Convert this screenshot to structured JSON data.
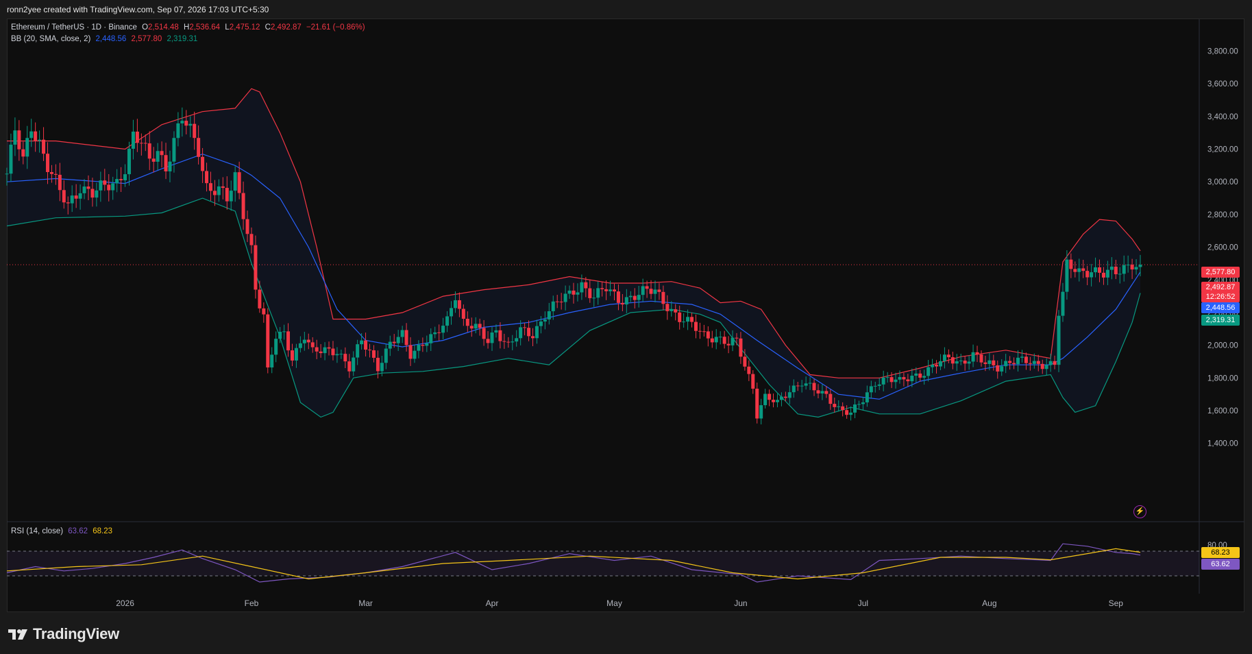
{
  "header": {
    "created_text": "ronn2yee created with TradingView.com, Sep 07, 2026 17:03 UTC+5:30"
  },
  "legend": {
    "symbol": "Ethereum / TetherUS · 1D · Binance",
    "o_label": "O",
    "o_value": "2,514.48",
    "h_label": "H",
    "h_value": "2,536.64",
    "l_label": "L",
    "l_value": "2,475.12",
    "c_label": "C",
    "c_value": "2,492.87",
    "change": "−21.61 (−0.86%)",
    "bb_label": "BB (20, SMA, close, 2)",
    "bb_basis": "2,448.56",
    "bb_upper": "2,577.80",
    "bb_lower": "2,319.31"
  },
  "rsi_legend": {
    "label": "RSI (14, close)",
    "rsi_value": "63.62",
    "ma_value": "68.23"
  },
  "price_tags": {
    "upper": "2,577.80",
    "last": "2,492.87",
    "countdown": "12:26:52",
    "basis": "2,448.56",
    "lower": "2,319.31",
    "rsi_ma": "68.23",
    "rsi": "63.62"
  },
  "branding": {
    "name": "TradingView"
  },
  "colors": {
    "up": "#089981",
    "down": "#f23645",
    "upper_band": "#f23645",
    "basis": "#2962ff",
    "lower_band": "#089981",
    "rsi": "#7e57c2",
    "rsi_ma": "#f5c518"
  },
  "chart_data": {
    "type": "candlestick",
    "title": "Ethereum / TetherUS · 1D · Binance",
    "y_axis": {
      "ticks": [
        1400,
        1600,
        1800,
        2000,
        2200,
        2400,
        2600,
        2800,
        3000,
        3200,
        3400,
        3600,
        3800
      ],
      "tick_labels": [
        "1,400.00",
        "1,600.00",
        "1,800.00",
        "2,000.00",
        "2,200.00",
        "2,400.00",
        "2,600.00",
        "2,800.00",
        "3,000.00",
        "3,200.00",
        "3,400.00",
        "3,600.00",
        "3,800.00"
      ]
    },
    "x_axis": {
      "labels": [
        {
          "date": "2026-01-01",
          "text": "2026"
        },
        {
          "date": "2026-02-01",
          "text": "Feb"
        },
        {
          "date": "2026-03-01",
          "text": "Mar"
        },
        {
          "date": "2026-04-01",
          "text": "Apr"
        },
        {
          "date": "2026-05-01",
          "text": "May"
        },
        {
          "date": "2026-06-01",
          "text": "Jun"
        },
        {
          "date": "2026-07-01",
          "text": "Jul"
        },
        {
          "date": "2026-08-01",
          "text": "Aug"
        },
        {
          "date": "2026-09-01",
          "text": "Sep"
        }
      ]
    },
    "close_path": [
      [
        "2025-12-03",
        3050
      ],
      [
        "2025-12-05",
        3300
      ],
      [
        "2025-12-07",
        3120
      ],
      [
        "2025-12-09",
        3350
      ],
      [
        "2025-12-11",
        3250
      ],
      [
        "2025-12-13",
        3100
      ],
      [
        "2025-12-16",
        2930
      ],
      [
        "2025-12-18",
        2850
      ],
      [
        "2025-12-21",
        2980
      ],
      [
        "2025-12-24",
        2930
      ],
      [
        "2025-12-27",
        2960
      ],
      [
        "2025-12-30",
        3000
      ],
      [
        "2026-01-01",
        3100
      ],
      [
        "2026-01-03",
        3280
      ],
      [
        "2026-01-05",
        3230
      ],
      [
        "2026-01-07",
        3120
      ],
      [
        "2026-01-09",
        3200
      ],
      [
        "2026-01-11",
        3100
      ],
      [
        "2026-01-13",
        3250
      ],
      [
        "2026-01-15",
        3380
      ],
      [
        "2026-01-17",
        3300
      ],
      [
        "2026-01-19",
        3200
      ],
      [
        "2026-01-21",
        2980
      ],
      [
        "2026-01-24",
        2950
      ],
      [
        "2026-01-26",
        2880
      ],
      [
        "2026-01-28",
        3020
      ],
      [
        "2026-01-30",
        2820
      ],
      [
        "2026-02-01",
        2600
      ],
      [
        "2026-02-02",
        2350
      ],
      [
        "2026-02-03",
        2250
      ],
      [
        "2026-02-04",
        2170
      ],
      [
        "2026-02-05",
        1830
      ],
      [
        "2026-02-07",
        2050
      ],
      [
        "2026-02-09",
        2080
      ],
      [
        "2026-02-11",
        1930
      ],
      [
        "2026-02-14",
        2050
      ],
      [
        "2026-02-16",
        1950
      ],
      [
        "2026-02-19",
        1980
      ],
      [
        "2026-02-22",
        1970
      ],
      [
        "2026-02-25",
        1850
      ],
      [
        "2026-02-28",
        2030
      ],
      [
        "2026-03-02",
        1970
      ],
      [
        "2026-03-04",
        1870
      ],
      [
        "2026-03-07",
        2000
      ],
      [
        "2026-03-10",
        2060
      ],
      [
        "2026-03-12",
        1950
      ],
      [
        "2026-03-15",
        2020
      ],
      [
        "2026-03-18",
        2050
      ],
      [
        "2026-03-21",
        2150
      ],
      [
        "2026-03-23",
        2320
      ],
      [
        "2026-03-25",
        2150
      ],
      [
        "2026-03-28",
        2100
      ],
      [
        "2026-03-31",
        2020
      ],
      [
        "2026-04-02",
        2100
      ],
      [
        "2026-04-05",
        2000
      ],
      [
        "2026-04-08",
        2080
      ],
      [
        "2026-04-11",
        2060
      ],
      [
        "2026-04-14",
        2200
      ],
      [
        "2026-04-17",
        2260
      ],
      [
        "2026-04-20",
        2300
      ],
      [
        "2026-04-23",
        2380
      ],
      [
        "2026-04-26",
        2300
      ],
      [
        "2026-04-29",
        2340
      ],
      [
        "2026-05-02",
        2280
      ],
      [
        "2026-05-05",
        2300
      ],
      [
        "2026-05-08",
        2320
      ],
      [
        "2026-05-11",
        2330
      ],
      [
        "2026-05-14",
        2250
      ],
      [
        "2026-05-17",
        2160
      ],
      [
        "2026-05-20",
        2120
      ],
      [
        "2026-05-23",
        2070
      ],
      [
        "2026-05-26",
        2050
      ],
      [
        "2026-05-29",
        2000
      ],
      [
        "2026-05-31",
        2020
      ],
      [
        "2026-06-02",
        1880
      ],
      [
        "2026-06-04",
        1750
      ],
      [
        "2026-06-05",
        1580
      ],
      [
        "2026-06-07",
        1680
      ],
      [
        "2026-06-10",
        1640
      ],
      [
        "2026-06-13",
        1730
      ],
      [
        "2026-06-16",
        1780
      ],
      [
        "2026-06-19",
        1720
      ],
      [
        "2026-06-22",
        1690
      ],
      [
        "2026-06-25",
        1620
      ],
      [
        "2026-06-28",
        1580
      ],
      [
        "2026-07-01",
        1660
      ],
      [
        "2026-07-04",
        1780
      ],
      [
        "2026-07-07",
        1800
      ],
      [
        "2026-07-10",
        1770
      ],
      [
        "2026-07-13",
        1810
      ],
      [
        "2026-07-16",
        1840
      ],
      [
        "2026-07-19",
        1880
      ],
      [
        "2026-07-22",
        1920
      ],
      [
        "2026-07-25",
        1900
      ],
      [
        "2026-07-28",
        1940
      ],
      [
        "2026-07-31",
        1880
      ],
      [
        "2026-08-03",
        1870
      ],
      [
        "2026-08-06",
        1910
      ],
      [
        "2026-08-09",
        1900
      ],
      [
        "2026-08-12",
        1880
      ],
      [
        "2026-08-15",
        1895
      ],
      [
        "2026-08-17",
        1890
      ],
      [
        "2026-08-18",
        2200
      ],
      [
        "2026-08-19",
        2300
      ],
      [
        "2026-08-20",
        2480
      ],
      [
        "2026-08-23",
        2450
      ],
      [
        "2026-08-26",
        2470
      ],
      [
        "2026-08-29",
        2430
      ],
      [
        "2026-09-01",
        2440
      ],
      [
        "2026-09-03",
        2480
      ],
      [
        "2026-09-05",
        2510
      ],
      [
        "2026-09-07",
        2492.87
      ]
    ],
    "bollinger_upper_path": [
      [
        "2025-12-03",
        3250
      ],
      [
        "2025-12-15",
        3250
      ],
      [
        "2026-01-01",
        3200
      ],
      [
        "2026-01-10",
        3350
      ],
      [
        "2026-01-20",
        3430
      ],
      [
        "2026-01-28",
        3450
      ],
      [
        "2026-02-01",
        3570
      ],
      [
        "2026-02-03",
        3550
      ],
      [
        "2026-02-08",
        3300
      ],
      [
        "2026-02-13",
        3000
      ],
      [
        "2026-02-17",
        2600
      ],
      [
        "2026-02-21",
        2160
      ],
      [
        "2026-03-01",
        2160
      ],
      [
        "2026-03-10",
        2200
      ],
      [
        "2026-03-20",
        2300
      ],
      [
        "2026-03-30",
        2340
      ],
      [
        "2026-04-10",
        2370
      ],
      [
        "2026-04-20",
        2420
      ],
      [
        "2026-04-30",
        2380
      ],
      [
        "2026-05-08",
        2380
      ],
      [
        "2026-05-15",
        2390
      ],
      [
        "2026-05-22",
        2350
      ],
      [
        "2026-05-27",
        2260
      ],
      [
        "2026-06-01",
        2270
      ],
      [
        "2026-06-06",
        2220
      ],
      [
        "2026-06-12",
        2000
      ],
      [
        "2026-06-18",
        1820
      ],
      [
        "2026-06-25",
        1800
      ],
      [
        "2026-07-05",
        1800
      ],
      [
        "2026-07-15",
        1860
      ],
      [
        "2026-07-25",
        1930
      ],
      [
        "2026-08-05",
        1970
      ],
      [
        "2026-08-16",
        1920
      ],
      [
        "2026-08-19",
        2510
      ],
      [
        "2026-08-24",
        2680
      ],
      [
        "2026-08-28",
        2770
      ],
      [
        "2026-09-01",
        2760
      ],
      [
        "2026-09-05",
        2650
      ],
      [
        "2026-09-07",
        2577.8
      ]
    ],
    "bollinger_basis_path": [
      [
        "2025-12-03",
        3000
      ],
      [
        "2025-12-15",
        3020
      ],
      [
        "2026-01-01",
        2990
      ],
      [
        "2026-01-10",
        3080
      ],
      [
        "2026-01-20",
        3170
      ],
      [
        "2026-01-28",
        3100
      ],
      [
        "2026-02-01",
        3040
      ],
      [
        "2026-02-08",
        2900
      ],
      [
        "2026-02-15",
        2600
      ],
      [
        "2026-02-22",
        2220
      ],
      [
        "2026-03-01",
        2030
      ],
      [
        "2026-03-10",
        1990
      ],
      [
        "2026-03-20",
        2030
      ],
      [
        "2026-03-30",
        2110
      ],
      [
        "2026-04-10",
        2140
      ],
      [
        "2026-04-20",
        2200
      ],
      [
        "2026-04-30",
        2250
      ],
      [
        "2026-05-10",
        2270
      ],
      [
        "2026-05-20",
        2250
      ],
      [
        "2026-05-27",
        2190
      ],
      [
        "2026-06-05",
        2030
      ],
      [
        "2026-06-15",
        1860
      ],
      [
        "2026-06-25",
        1700
      ],
      [
        "2026-07-05",
        1670
      ],
      [
        "2026-07-15",
        1780
      ],
      [
        "2026-07-25",
        1830
      ],
      [
        "2026-08-05",
        1880
      ],
      [
        "2026-08-16",
        1880
      ],
      [
        "2026-08-19",
        1920
      ],
      [
        "2026-08-25",
        2050
      ],
      [
        "2026-09-01",
        2220
      ],
      [
        "2026-09-07",
        2448.56
      ]
    ],
    "bollinger_lower_path": [
      [
        "2025-12-03",
        2730
      ],
      [
        "2025-12-15",
        2780
      ],
      [
        "2026-01-01",
        2790
      ],
      [
        "2026-01-10",
        2810
      ],
      [
        "2026-01-20",
        2900
      ],
      [
        "2026-01-28",
        2820
      ],
      [
        "2026-02-01",
        2500
      ],
      [
        "2026-02-08",
        2050
      ],
      [
        "2026-02-13",
        1650
      ],
      [
        "2026-02-18",
        1560
      ],
      [
        "2026-02-21",
        1590
      ],
      [
        "2026-02-26",
        1800
      ],
      [
        "2026-03-05",
        1830
      ],
      [
        "2026-03-15",
        1840
      ],
      [
        "2026-03-25",
        1870
      ],
      [
        "2026-04-05",
        1920
      ],
      [
        "2026-04-15",
        1880
      ],
      [
        "2026-04-25",
        2090
      ],
      [
        "2026-05-05",
        2200
      ],
      [
        "2026-05-15",
        2220
      ],
      [
        "2026-05-22",
        2190
      ],
      [
        "2026-05-27",
        2140
      ],
      [
        "2026-06-01",
        1980
      ],
      [
        "2026-06-08",
        1760
      ],
      [
        "2026-06-15",
        1580
      ],
      [
        "2026-06-20",
        1560
      ],
      [
        "2026-06-28",
        1620
      ],
      [
        "2026-07-05",
        1580
      ],
      [
        "2026-07-15",
        1580
      ],
      [
        "2026-07-25",
        1660
      ],
      [
        "2026-08-05",
        1780
      ],
      [
        "2026-08-16",
        1820
      ],
      [
        "2026-08-19",
        1680
      ],
      [
        "2026-08-22",
        1590
      ],
      [
        "2026-08-27",
        1630
      ],
      [
        "2026-09-01",
        1900
      ],
      [
        "2026-09-05",
        2140
      ],
      [
        "2026-09-07",
        2319.31
      ]
    ],
    "rsi": {
      "levels": [
        70,
        30
      ],
      "tick_labels": [
        "80.00"
      ],
      "rsi_path": [
        [
          "2025-12-03",
          35
        ],
        [
          "2025-12-10",
          45
        ],
        [
          "2025-12-17",
          38
        ],
        [
          "2025-12-24",
          42
        ],
        [
          "2026-01-01",
          50
        ],
        [
          "2026-01-08",
          60
        ],
        [
          "2026-01-15",
          72
        ],
        [
          "2026-01-20",
          58
        ],
        [
          "2026-01-28",
          40
        ],
        [
          "2026-02-03",
          20
        ],
        [
          "2026-02-10",
          25
        ],
        [
          "2026-02-20",
          28
        ],
        [
          "2026-03-01",
          35
        ],
        [
          "2026-03-10",
          45
        ],
        [
          "2026-03-23",
          68
        ],
        [
          "2026-04-01",
          40
        ],
        [
          "2026-04-10",
          50
        ],
        [
          "2026-04-20",
          66
        ],
        [
          "2026-05-01",
          55
        ],
        [
          "2026-05-10",
          62
        ],
        [
          "2026-05-20",
          40
        ],
        [
          "2026-06-01",
          32
        ],
        [
          "2026-06-05",
          20
        ],
        [
          "2026-06-15",
          30
        ],
        [
          "2026-06-28",
          24
        ],
        [
          "2026-07-05",
          55
        ],
        [
          "2026-07-15",
          58
        ],
        [
          "2026-07-25",
          62
        ],
        [
          "2026-08-05",
          58
        ],
        [
          "2026-08-16",
          55
        ],
        [
          "2026-08-19",
          82
        ],
        [
          "2026-08-25",
          78
        ],
        [
          "2026-09-01",
          68
        ],
        [
          "2026-09-05",
          66
        ],
        [
          "2026-09-07",
          63.62
        ]
      ],
      "ma_path": [
        [
          "2025-12-03",
          38
        ],
        [
          "2025-12-20",
          45
        ],
        [
          "2026-01-05",
          48
        ],
        [
          "2026-01-20",
          62
        ],
        [
          "2026-02-01",
          45
        ],
        [
          "2026-02-15",
          25
        ],
        [
          "2026-03-01",
          35
        ],
        [
          "2026-03-20",
          50
        ],
        [
          "2026-04-05",
          55
        ],
        [
          "2026-04-25",
          62
        ],
        [
          "2026-05-15",
          55
        ],
        [
          "2026-05-30",
          35
        ],
        [
          "2026-06-15",
          25
        ],
        [
          "2026-07-01",
          35
        ],
        [
          "2026-07-20",
          60
        ],
        [
          "2026-08-05",
          60
        ],
        [
          "2026-08-16",
          56
        ],
        [
          "2026-08-25",
          66
        ],
        [
          "2026-09-01",
          74
        ],
        [
          "2026-09-07",
          68.23
        ]
      ]
    },
    "grid": false
  }
}
